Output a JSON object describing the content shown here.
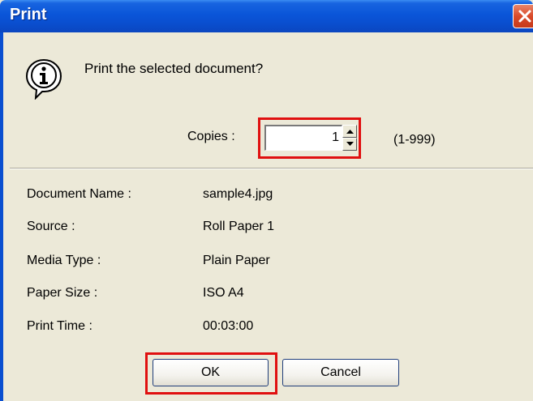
{
  "window": {
    "title": "Print"
  },
  "dialog": {
    "question": "Print the selected document?",
    "copies_label": "Copies :",
    "copies_value": "1",
    "copies_range": "(1-999)"
  },
  "details": [
    {
      "label": "Document Name :",
      "value": "sample4.jpg"
    },
    {
      "label": "Source :",
      "value": "Roll Paper 1"
    },
    {
      "label": "Media Type :",
      "value": "Plain Paper"
    },
    {
      "label": "Paper Size :",
      "value": "ISO A4"
    },
    {
      "label": "Print Time :",
      "value": "00:03:00"
    }
  ],
  "buttons": {
    "ok": "OK",
    "cancel": "Cancel"
  },
  "icons": {
    "info": "information-icon",
    "close": "close-icon",
    "spin_up": "spin-up-arrow-icon",
    "spin_down": "spin-down-arrow-icon"
  },
  "colors": {
    "titlebar": "#0a4fd0",
    "dialog_bg": "#ece9d8",
    "highlight": "#e01010",
    "close_button": "#d94a2a"
  }
}
